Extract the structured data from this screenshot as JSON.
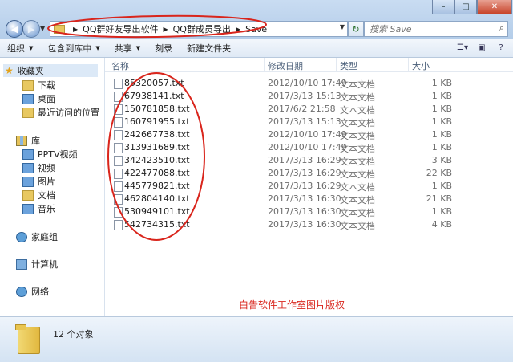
{
  "window": {
    "min_glyph": "–",
    "max_glyph": "□",
    "close_glyph": "✕"
  },
  "address": {
    "crumbs": [
      "QQ群好友导出软件",
      "QQ群成员导出",
      "Save"
    ]
  },
  "search": {
    "placeholder": "搜索 Save"
  },
  "toolbar": {
    "organize": "组织",
    "include_library": "包含到库中",
    "share": "共享",
    "burn": "刻录",
    "new_folder": "新建文件夹"
  },
  "nav": {
    "favorites": "收藏夹",
    "downloads": "下载",
    "desktop": "桌面",
    "recent": "最近访问的位置",
    "libraries": "库",
    "pptv": "PPTV视频",
    "videos": "视频",
    "pictures": "图片",
    "documents": "文档",
    "music": "音乐",
    "homegroup": "家庭组",
    "computer": "计算机",
    "network": "网络"
  },
  "columns": {
    "name": "名称",
    "modified": "修改日期",
    "type": "类型",
    "size": "大小"
  },
  "files": [
    {
      "name": "85320057.txt",
      "date": "2012/10/10 17:49",
      "type": "文本文档",
      "size": "1 KB"
    },
    {
      "name": "67938141.txt",
      "date": "2017/3/13 15:13",
      "type": "文本文档",
      "size": "1 KB"
    },
    {
      "name": "150781858.txt",
      "date": "2017/6/2 21:58",
      "type": "文本文档",
      "size": "1 KB"
    },
    {
      "name": "160791955.txt",
      "date": "2017/3/13 15:13",
      "type": "文本文档",
      "size": "1 KB"
    },
    {
      "name": "242667738.txt",
      "date": "2012/10/10 17:49",
      "type": "文本文档",
      "size": "1 KB"
    },
    {
      "name": "313931689.txt",
      "date": "2012/10/10 17:49",
      "type": "文本文档",
      "size": "1 KB"
    },
    {
      "name": "342423510.txt",
      "date": "2017/3/13 16:29",
      "type": "文本文档",
      "size": "3 KB"
    },
    {
      "name": "422477088.txt",
      "date": "2017/3/13 16:29",
      "type": "文本文档",
      "size": "22 KB"
    },
    {
      "name": "445779821.txt",
      "date": "2017/3/13 16:29",
      "type": "文本文档",
      "size": "1 KB"
    },
    {
      "name": "462804140.txt",
      "date": "2017/3/13 16:30",
      "type": "文本文档",
      "size": "21 KB"
    },
    {
      "name": "530949101.txt",
      "date": "2017/3/13 16:30",
      "type": "文本文档",
      "size": "1 KB"
    },
    {
      "name": "542734315.txt",
      "date": "2017/3/13 16:30",
      "type": "文本文档",
      "size": "4 KB"
    }
  ],
  "watermark": "白告软件工作室图片版权",
  "status": {
    "count": "12 个对象"
  },
  "colors": {
    "annotation_red": "#d9251c",
    "nav_highlight": "#dce9f7"
  }
}
